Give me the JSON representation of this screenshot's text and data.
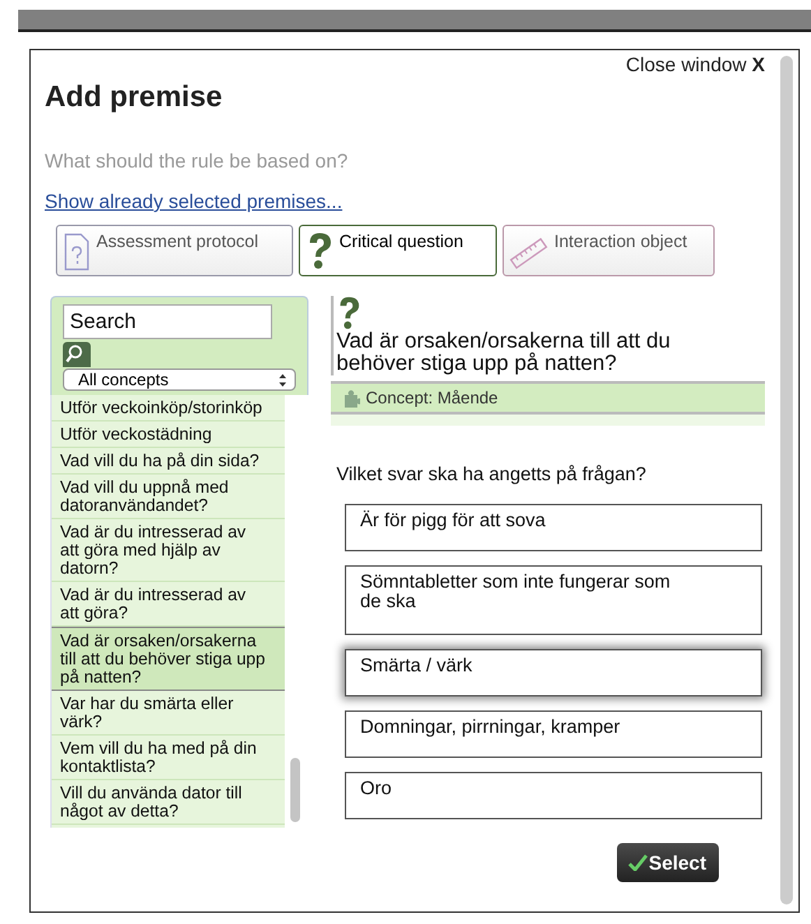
{
  "close_link": "Close window **X**",
  "title": "Add premise",
  "subtitle": "What should the rule be based on?",
  "show_selected_link": "Show already selected premises...",
  "tabs": [
    {
      "label": "Assessment protocol",
      "kind": "protocol",
      "selected": false
    },
    {
      "label": "Critical question",
      "kind": "question",
      "selected": true
    },
    {
      "label": "Interaction object",
      "kind": "ruler",
      "selected": false
    }
  ],
  "sidebar": {
    "search": {
      "placeholder": "Search"
    },
    "filter": "All concepts",
    "items": [
      {
        "label": "Utför veckoinköp/storinköp",
        "selected": false
      },
      {
        "label": "Utför veckostädning",
        "selected": false
      },
      {
        "label": "Vad vill du ha på din sida?",
        "selected": false
      },
      {
        "label": "Vad vill du uppnå med datoranvändandet?",
        "selected": false
      },
      {
        "label": "Vad är du intresserad av att göra med hjälp av datorn?",
        "selected": false
      },
      {
        "label": "Vad är du intresserad av att göra?",
        "selected": false
      },
      {
        "label": "Vad är orsaken/orsakerna till att du behöver stiga upp på natten?",
        "selected": true
      },
      {
        "label": "Var har du smärta eller värk?",
        "selected": false
      },
      {
        "label": "Vem vill du ha med på din kontaktlista?",
        "selected": false
      },
      {
        "label": "Vill du använda dator till något av detta?",
        "selected": false
      }
    ]
  },
  "detail": {
    "question": "Vad är orsaken/orsakerna till att du behöver stiga upp på natten?",
    "concept": "Concept: Mående",
    "prompt": "Vilket svar ska ha angetts på frågan?",
    "answers": [
      {
        "label": "Är för pigg för att sova",
        "selected": false
      },
      {
        "label": "Sömntabletter som inte fungerar som de ska",
        "selected": false
      },
      {
        "label": "Smärta / värk",
        "selected": true
      },
      {
        "label": "Domningar, pirrningar, kramper",
        "selected": false
      },
      {
        "label": "Oro",
        "selected": false
      }
    ]
  },
  "select_button": "Select"
}
